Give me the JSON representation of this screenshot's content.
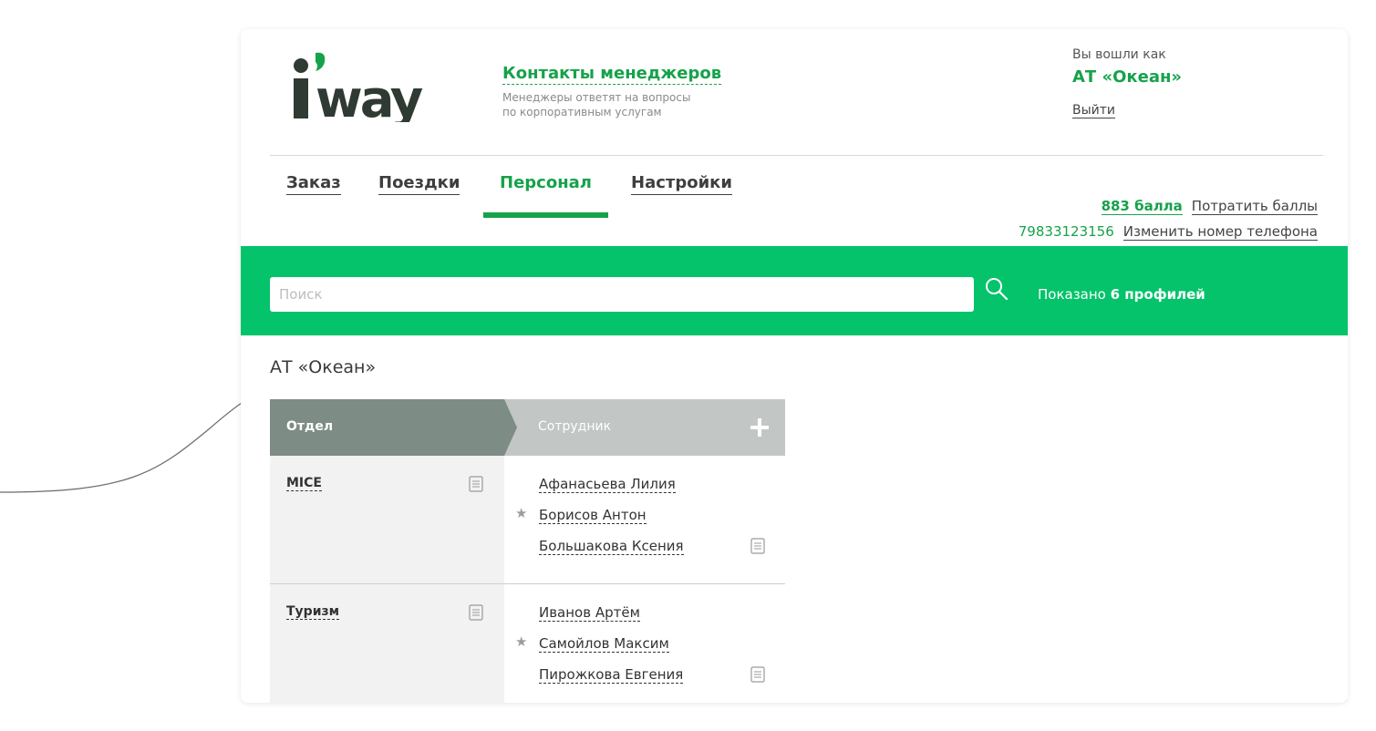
{
  "brand": {
    "logo_text": "i’way",
    "colors": {
      "primary": "#16a24a",
      "band": "#05c36b",
      "dept_header": "#7e8c86",
      "emp_header": "#c2c7c5"
    }
  },
  "contacts": {
    "title": "Контакты менеджеров",
    "subtitle_line1": "Менеджеры ответят на вопросы",
    "subtitle_line2": "по корпоративным услугам"
  },
  "account": {
    "logged_in_prefix": "Вы вошли как",
    "company": "АТ «Океан»",
    "logout": "Выйти"
  },
  "nav": {
    "tabs": [
      {
        "label": "Заказ",
        "active": false
      },
      {
        "label": "Поездки",
        "active": false
      },
      {
        "label": "Персонал",
        "active": true
      },
      {
        "label": "Настройки",
        "active": false
      }
    ]
  },
  "points": {
    "count": "883 балла",
    "spend": "Потратить баллы",
    "phone": "79833123156",
    "change_phone": "Изменить номер телефона"
  },
  "search": {
    "placeholder": "Поиск",
    "value": "",
    "shown_prefix": "Показано ",
    "shown_count": "6 профилей"
  },
  "company_name": "АТ «Океан»",
  "table": {
    "dept_header": "Отдел",
    "emp_header": "Сотрудник",
    "departments": [
      {
        "name": "MICE",
        "employees": [
          {
            "name": "Афанасьева Лилия",
            "starred": false,
            "doc": false
          },
          {
            "name": "Борисов Антон",
            "starred": true,
            "doc": false
          },
          {
            "name": "Большакова Ксения",
            "starred": false,
            "doc": true
          }
        ]
      },
      {
        "name": "Туризм",
        "employees": [
          {
            "name": "Иванов Артём",
            "starred": false,
            "doc": false
          },
          {
            "name": "Самойлов Максим",
            "starred": true,
            "doc": false
          },
          {
            "name": "Пирожкова Евгения",
            "starred": false,
            "doc": true
          }
        ]
      }
    ]
  },
  "icons": {
    "search": "search-icon",
    "add": "plus-icon",
    "document": "document-icon",
    "star": "star-icon"
  }
}
